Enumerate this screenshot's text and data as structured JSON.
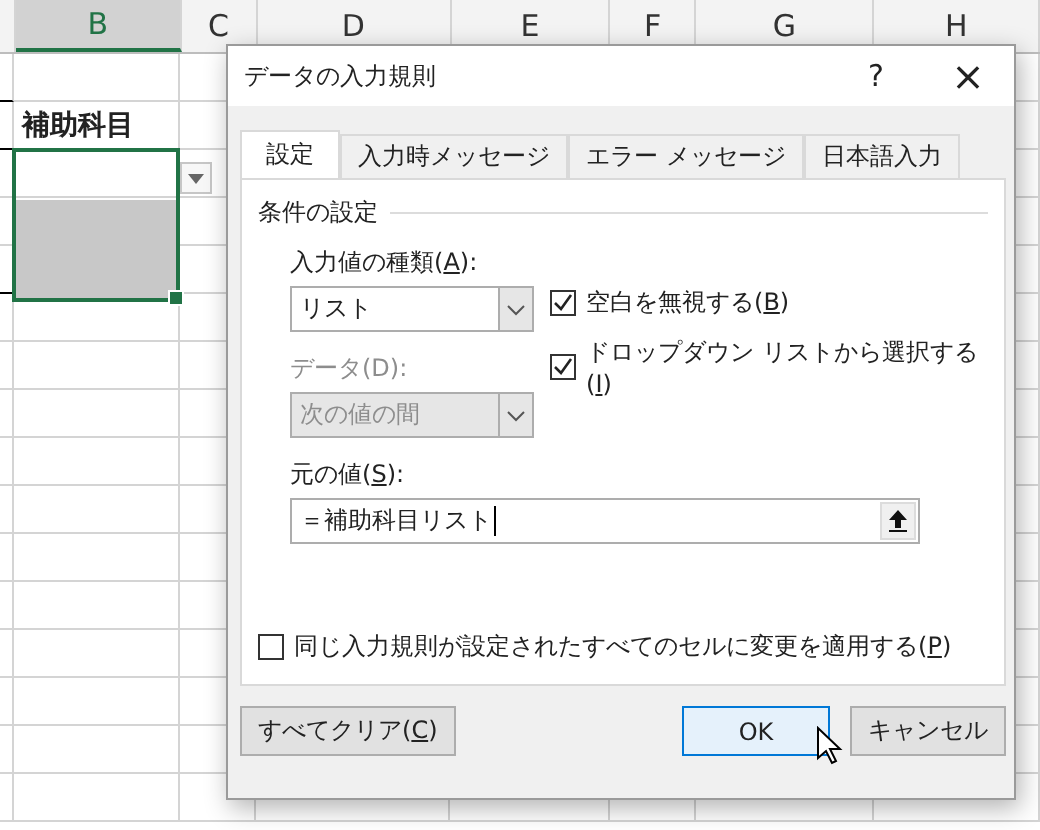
{
  "sheet": {
    "columns": [
      {
        "label": "B",
        "selected": true
      },
      {
        "label": "C",
        "selected": false
      },
      {
        "label": "D",
        "selected": false
      },
      {
        "label": "E",
        "selected": false
      },
      {
        "label": "F",
        "selected": false
      },
      {
        "label": "G",
        "selected": false
      },
      {
        "label": "H",
        "selected": false
      }
    ],
    "header_cell": "補助科目"
  },
  "dialog": {
    "title": "データの入力規則",
    "help": "?",
    "close": "×",
    "tabs": [
      {
        "label": "設定",
        "selected": true
      },
      {
        "label": "入力時メッセージ",
        "selected": false
      },
      {
        "label": "エラー メッセージ",
        "selected": false
      },
      {
        "label": "日本語入力",
        "selected": false
      }
    ],
    "group": "条件の設定",
    "type_label": [
      "入力値の種類(",
      "A",
      "):"
    ],
    "type_value": "リスト",
    "data_label": "データ(D):",
    "data_value": "次の値の間",
    "data_disabled": true,
    "checks": [
      {
        "label": [
          "空白を無視する(",
          "B",
          ")"
        ],
        "checked": true
      },
      {
        "label": [
          "ドロップダウン リストから選択する(",
          "I",
          ")"
        ],
        "checked": true
      }
    ],
    "source_label": [
      "元の値(",
      "S",
      "):"
    ],
    "source_value": "＝補助科目リスト",
    "apply_all": {
      "label": [
        "同じ入力規則が設定されたすべてのセルに変更を適用する(",
        "P",
        ")"
      ],
      "checked": false
    },
    "buttons": [
      {
        "label": [
          "すべてクリア(",
          "C",
          ")"
        ],
        "default": false
      },
      {
        "label": [
          "OK"
        ],
        "default": true
      },
      {
        "label": [
          "キャンセル"
        ],
        "default": false
      }
    ]
  }
}
